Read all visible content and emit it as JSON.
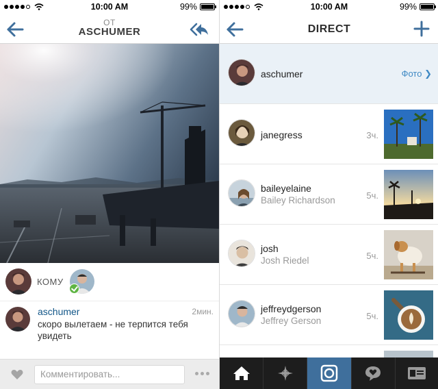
{
  "status": {
    "time": "10:00 AM",
    "battery": "99%"
  },
  "left": {
    "header": {
      "subtitle": "ОТ",
      "title": "ASCHUMER"
    },
    "recipients_label": "КОМУ",
    "comment": {
      "user": "aschumer",
      "time": "2мин.",
      "text": "скоро вылетаем - не терпится тебя увидеть"
    },
    "input": {
      "placeholder": "Комментировать..."
    }
  },
  "right": {
    "title": "DIRECT",
    "threads": [
      {
        "name": "aschumer",
        "fullname": "",
        "time": "",
        "link": "Фото"
      },
      {
        "name": "janegress",
        "fullname": "",
        "time": "3ч.",
        "link": ""
      },
      {
        "name": "baileyelaine",
        "fullname": "Bailey Richardson",
        "time": "5ч.",
        "link": ""
      },
      {
        "name": "josh",
        "fullname": "Josh Riedel",
        "time": "5ч.",
        "link": ""
      },
      {
        "name": "jeffreydgerson",
        "fullname": "Jeffrey Gerson",
        "time": "5ч.",
        "link": ""
      }
    ]
  },
  "colors": {
    "accent": "#3f6f9c",
    "link": "#125688",
    "tabbar": "#1d1d1d"
  },
  "tabs": [
    "home-icon",
    "explore-icon",
    "camera-icon",
    "activity-icon",
    "profile-icon"
  ]
}
